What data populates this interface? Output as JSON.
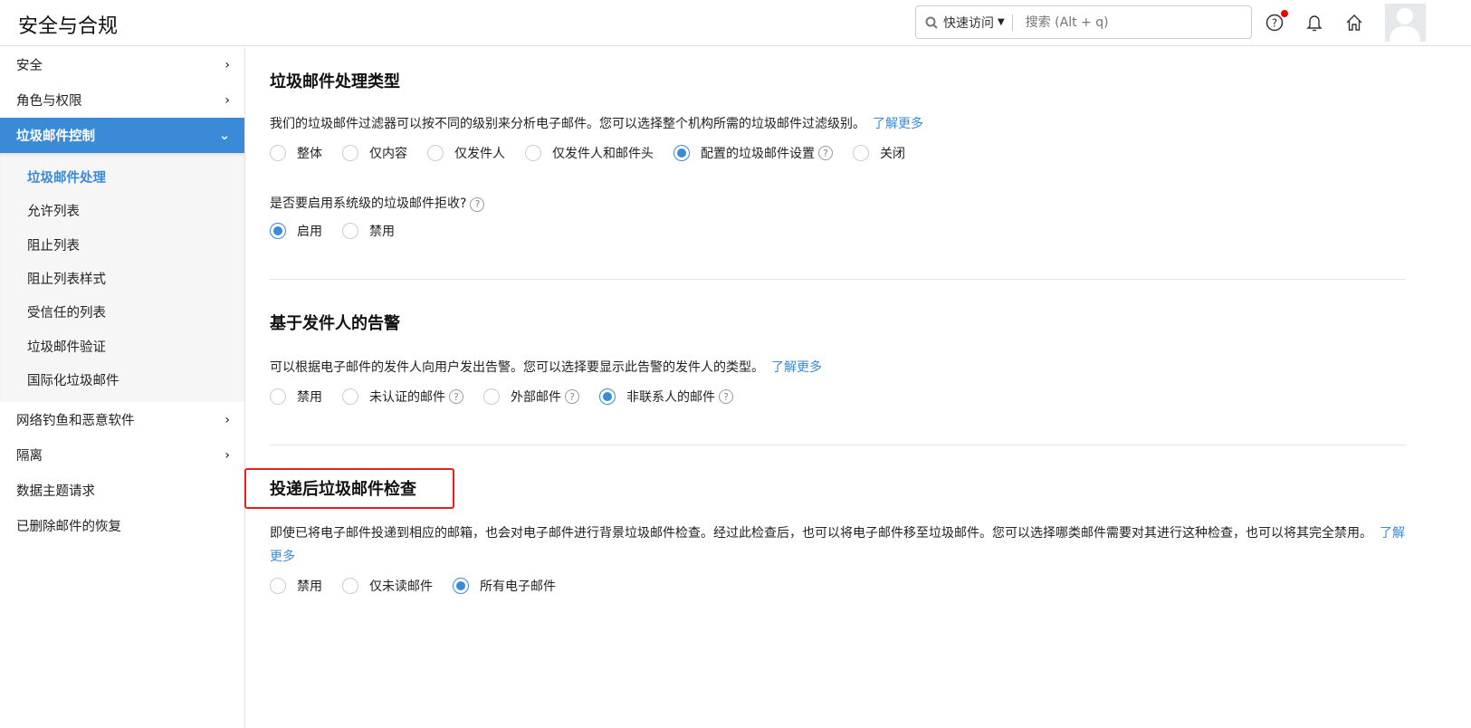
{
  "header": {
    "title": "安全与合规",
    "quick_access": "快速访问",
    "search_placeholder": "搜索 (Alt + q)"
  },
  "sidebar": {
    "items": [
      {
        "label": "安全"
      },
      {
        "label": "角色与权限"
      },
      {
        "label": "垃圾邮件控制"
      }
    ],
    "sub_items": [
      {
        "label": "垃圾邮件处理"
      },
      {
        "label": "允许列表"
      },
      {
        "label": "阻止列表"
      },
      {
        "label": "阻止列表样式"
      },
      {
        "label": "受信任的列表"
      },
      {
        "label": "垃圾邮件验证"
      },
      {
        "label": "国际化垃圾邮件"
      }
    ],
    "items_after": [
      {
        "label": "网络钓鱼和恶意软件"
      },
      {
        "label": "隔离"
      },
      {
        "label": "数据主题请求"
      },
      {
        "label": "已删除邮件的恢复"
      }
    ]
  },
  "sections": [
    {
      "title": "垃圾邮件处理类型",
      "desc": "我们的垃圾邮件过滤器可以按不同的级别来分析电子邮件。您可以选择整个机构所需的垃圾邮件过滤级别。",
      "link": "了解更多",
      "options": [
        "整体",
        "仅内容",
        "仅发件人",
        "仅发件人和邮件头",
        "配置的垃圾邮件设置",
        "关闭"
      ],
      "selected": 4,
      "question": "是否要启用系统级的垃圾邮件拒收?",
      "q_options": [
        "启用",
        "禁用"
      ],
      "q_selected": 0
    },
    {
      "title": "基于发件人的告警",
      "desc": "可以根据电子邮件的发件人向用户发出告警。您可以选择要显示此告警的发件人的类型。",
      "link": "了解更多",
      "options": [
        "禁用",
        "未认证的邮件",
        "外部邮件",
        "非联系人的邮件"
      ],
      "selected": 3
    },
    {
      "title": "投递后垃圾邮件检查",
      "desc": "即使已将电子邮件投递到相应的邮箱，也会对电子邮件进行背景垃圾邮件检查。经过此检查后，也可以将电子邮件移至垃圾邮件。您可以选择哪类邮件需要对其进行这种检查，也可以将其完全禁用。",
      "link": "了解更多",
      "options": [
        "禁用",
        "仅未读邮件",
        "所有电子邮件"
      ],
      "selected": 2
    }
  ],
  "colors": {
    "accent": "#3a8ad8",
    "highlight": "#e8201c"
  }
}
